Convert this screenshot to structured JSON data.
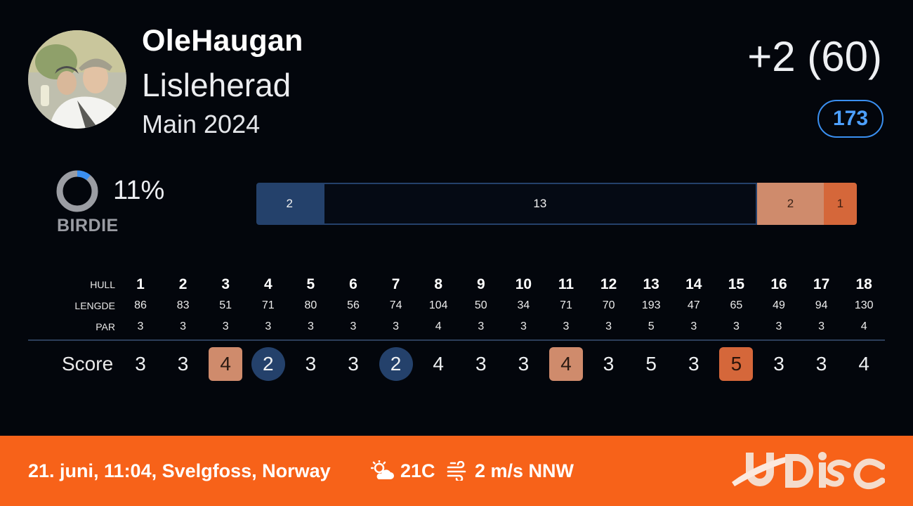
{
  "player": {
    "name": "OleHaugan",
    "course": "Lisleherad",
    "layout": "Main 2024"
  },
  "total": {
    "score": "+2 (60)",
    "rating": "173"
  },
  "stat": {
    "percent": "11%",
    "label": "BIRDIE",
    "fraction": 0.11
  },
  "distribution": [
    {
      "type": "birdie",
      "count": "2"
    },
    {
      "type": "par",
      "count": "13"
    },
    {
      "type": "bogey",
      "count": "2"
    },
    {
      "type": "double",
      "count": "1"
    }
  ],
  "scorecard": {
    "labels": {
      "hole": "HULL",
      "length": "LENGDE",
      "par": "PAR",
      "score": "Score"
    },
    "holes": [
      "1",
      "2",
      "3",
      "4",
      "5",
      "6",
      "7",
      "8",
      "9",
      "10",
      "11",
      "12",
      "13",
      "14",
      "15",
      "16",
      "17",
      "18"
    ],
    "lengths": [
      "86",
      "83",
      "51",
      "71",
      "80",
      "56",
      "74",
      "104",
      "50",
      "34",
      "71",
      "70",
      "193",
      "47",
      "65",
      "49",
      "94",
      "130"
    ],
    "pars": [
      "3",
      "3",
      "3",
      "3",
      "3",
      "3",
      "3",
      "4",
      "3",
      "3",
      "3",
      "3",
      "5",
      "3",
      "3",
      "3",
      "3",
      "4"
    ],
    "scores": [
      "3",
      "3",
      "4",
      "2",
      "3",
      "3",
      "2",
      "4",
      "3",
      "3",
      "4",
      "3",
      "5",
      "3",
      "5",
      "3",
      "3",
      "4"
    ],
    "score_types": [
      "par",
      "par",
      "bogey",
      "birdie",
      "par",
      "par",
      "birdie",
      "par",
      "par",
      "par",
      "bogey",
      "par",
      "par",
      "par",
      "double",
      "par",
      "par",
      "par"
    ]
  },
  "footer": {
    "info": "21. juni, 11:04, Svelgfoss, Norway",
    "temperature": "21C",
    "wind": "2 m/s NNW",
    "weather_icon": "partly-cloudy-icon",
    "wind_icon": "wind-icon",
    "logo": "UDisc"
  },
  "colors": {
    "background": "#03060c",
    "birdie": "#24416b",
    "bogey": "#cf8b6c",
    "double": "#d5673a",
    "accent": "#3a8ff0",
    "footer": "#f76219"
  }
}
